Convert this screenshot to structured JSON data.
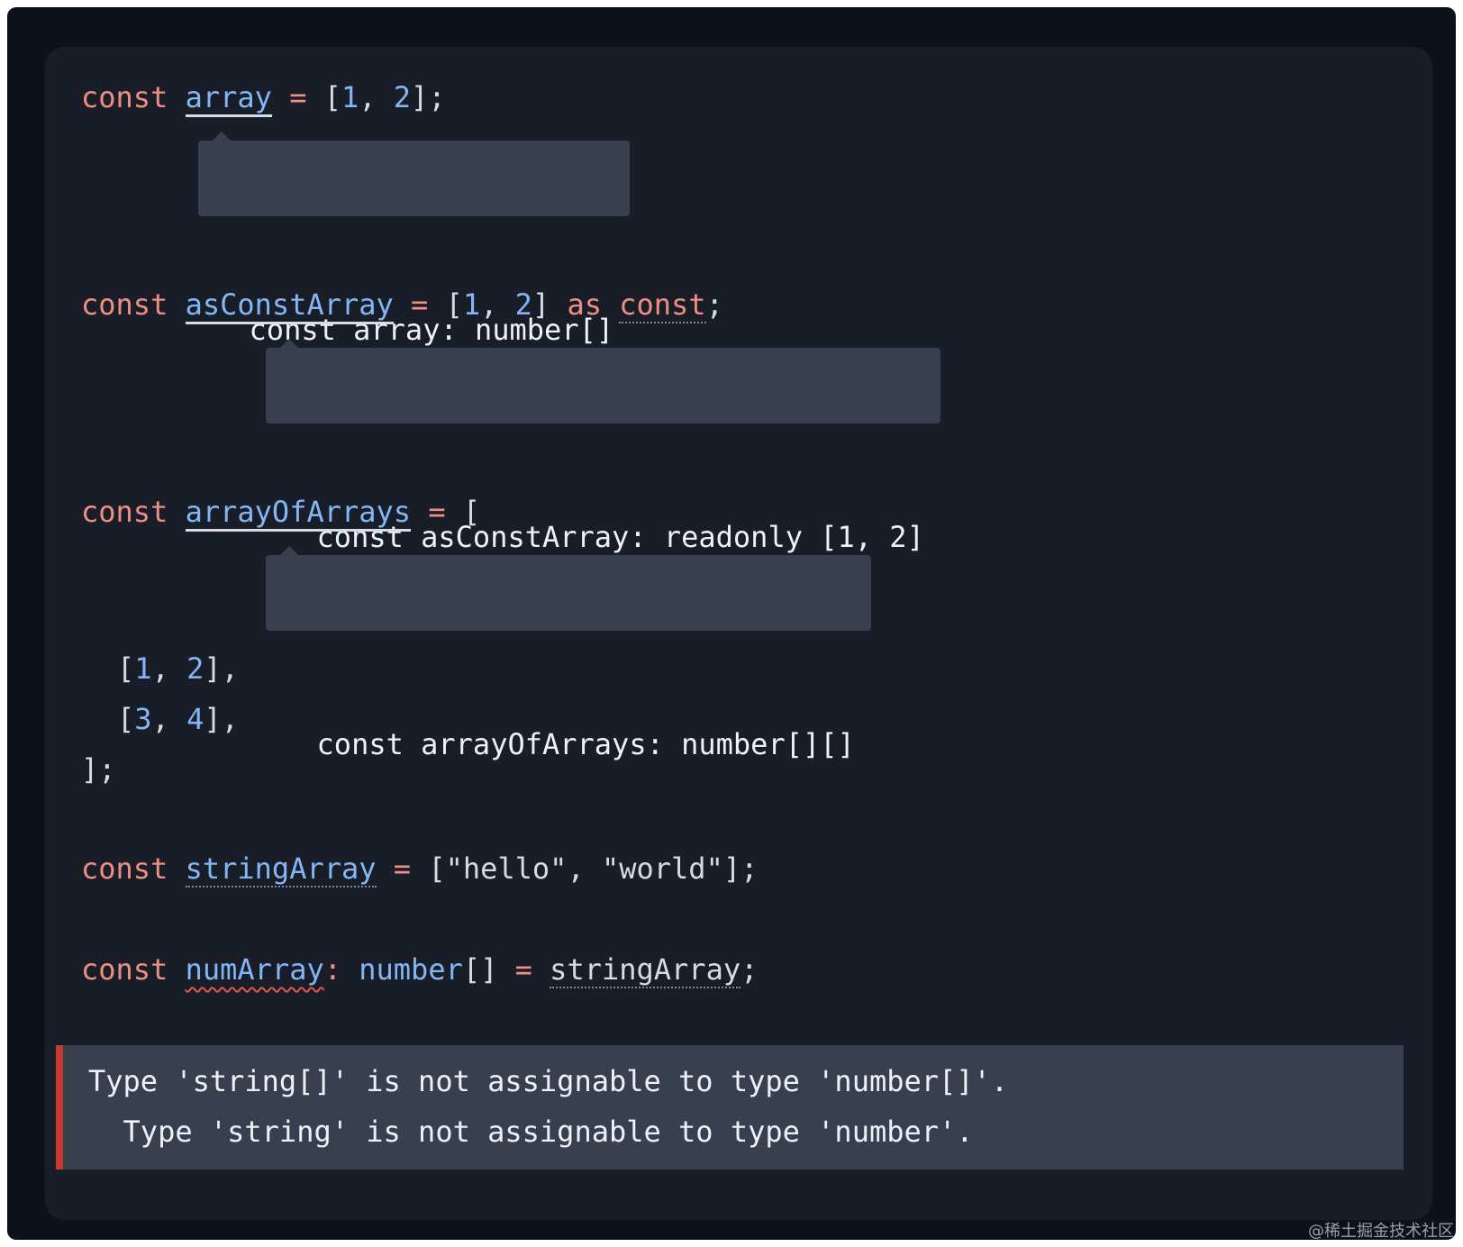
{
  "code": {
    "line1": {
      "kw": "const",
      "name": "array",
      "eq": "=",
      "open": "[",
      "n1": "1",
      "comma": ", ",
      "n2": "2",
      "close": "];"
    },
    "tooltip1": "const array: number[]",
    "line2": {
      "kw": "const",
      "name": "asConstArray",
      "eq": "=",
      "open": "[",
      "n1": "1",
      "comma": ", ",
      "n2": "2",
      "close": "]",
      "as": "as",
      "const": "const",
      "semi": ";"
    },
    "tooltip2": "const asConstArray: readonly [1, 2]",
    "line3": {
      "kw": "const",
      "name": "arrayOfArrays",
      "eq": "=",
      "open": "["
    },
    "tooltip3": "const arrayOfArrays: number[][]",
    "line4": {
      "open": "[",
      "n1": "1",
      "comma": ", ",
      "n2": "2",
      "close": "],"
    },
    "line5": {
      "open": "[",
      "n1": "3",
      "comma": ", ",
      "n2": "4",
      "close": "],"
    },
    "line6": "];",
    "line7": {
      "kw": "const",
      "name": "stringArray",
      "eq": "=",
      "open": "[",
      "s1": "\"hello\"",
      "comma": ", ",
      "s2": "\"world\"",
      "close": "];"
    },
    "line8": {
      "kw": "const",
      "name": "numArray",
      "colon": ":",
      "type": "number",
      "brackets": "[]",
      "eq": "=",
      "value": "stringArray",
      "semi": ";"
    }
  },
  "error": {
    "line1": "Type 'string[]' is not assignable to type 'number[]'.",
    "line2": "  Type 'string' is not assignable to type 'number'."
  },
  "watermark": "@稀土掘金技术社区"
}
